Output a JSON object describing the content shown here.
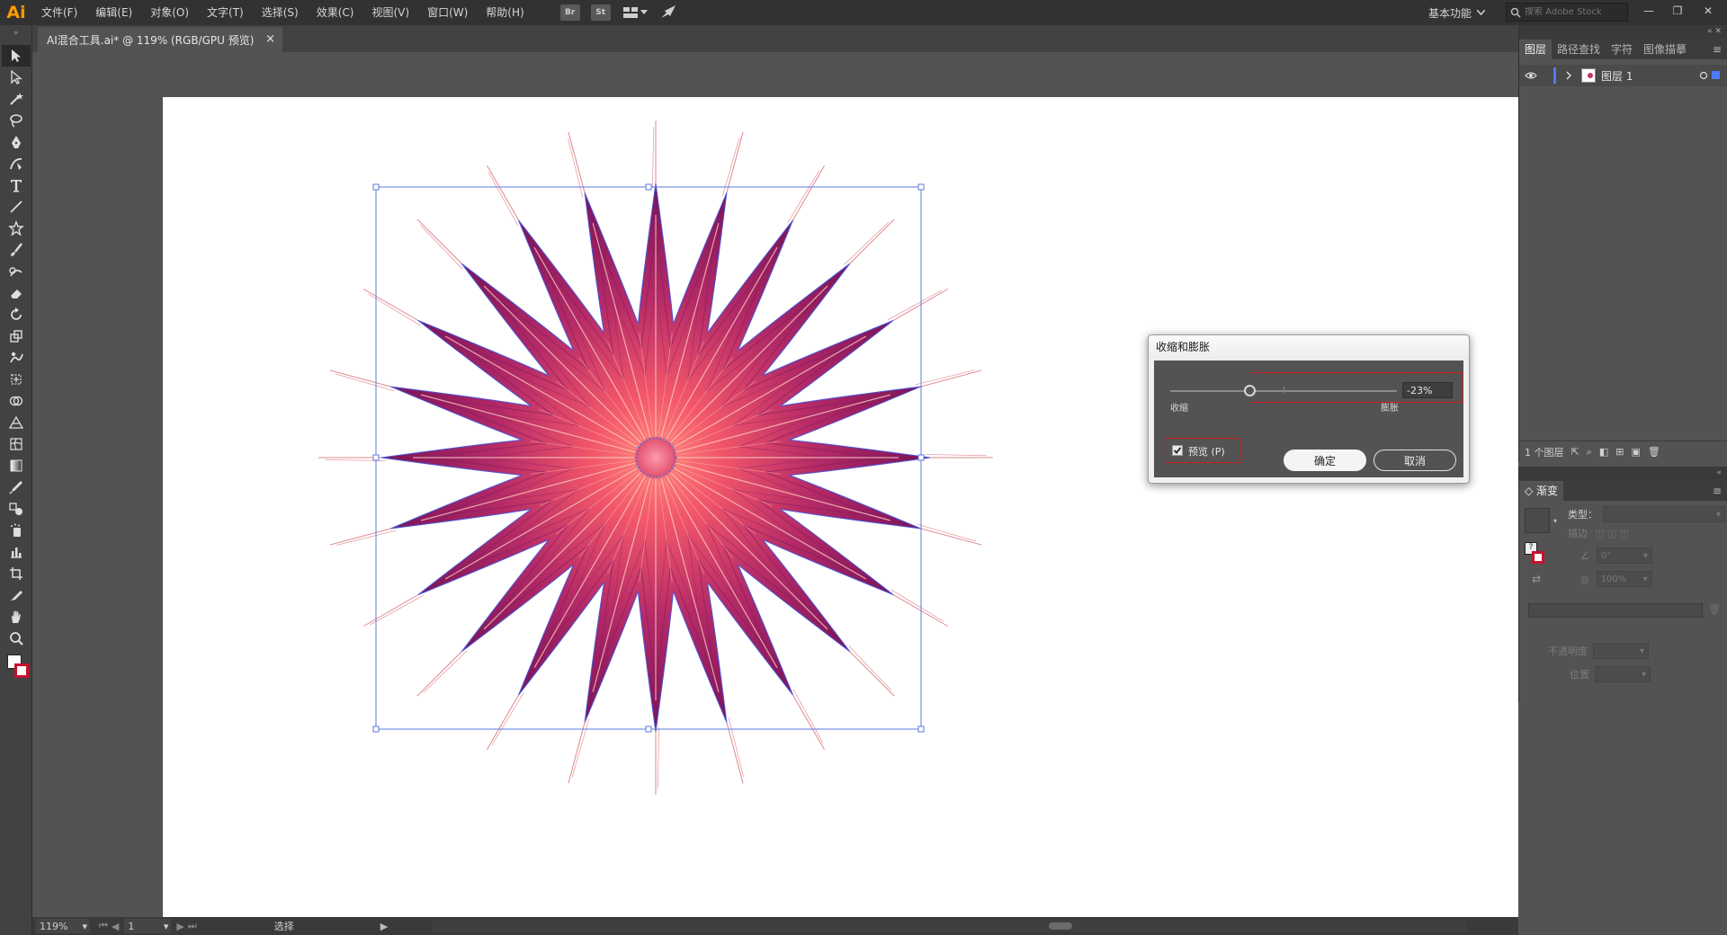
{
  "app": {
    "logo": "Ai",
    "menus": [
      "文件(F)",
      "编辑(E)",
      "对象(O)",
      "文字(T)",
      "选择(S)",
      "效果(C)",
      "视图(V)",
      "窗口(W)",
      "帮助(H)"
    ],
    "menu_icons": [
      "Br",
      "St"
    ],
    "workspace": "基本功能",
    "stock_search_placeholder": "搜索 Adobe Stock"
  },
  "document": {
    "tab_title": "AI混合工具.ai* @ 119% (RGB/GPU 预览)",
    "tab_close": "×"
  },
  "tools": [
    "selection-tool",
    "direct-selection-tool",
    "magic-wand-tool",
    "lasso-tool",
    "pen-tool",
    "curvature-tool",
    "type-tool",
    "line-tool",
    "star-tool",
    "paintbrush-tool",
    "shaper-tool",
    "eraser-tool",
    "rotate-tool",
    "scale-tool",
    "warp-tool",
    "free-transform-tool",
    "shape-builder-tool",
    "perspective-tool",
    "mesh-tool",
    "gradient-tool",
    "eyedropper-tool",
    "blend-tool",
    "symbol-sprayer-tool",
    "graph-tool",
    "artboard-tool",
    "slice-tool",
    "hand-tool",
    "zoom-tool"
  ],
  "layers_panel": {
    "tabs": [
      "图层",
      "路径查找",
      "字符",
      "图像描摹"
    ],
    "active_tab": "图层",
    "layer_name": "图层 1",
    "footer_count": "1 个图层"
  },
  "gradient_panel": {
    "title": "渐变",
    "type_label": "类型：",
    "stroke_label": "描边",
    "angle_value": "0°",
    "aspect_value": "100%",
    "opacity_label": "不透明度",
    "location_label": "位置"
  },
  "dialog": {
    "title": "收缩和膨胀",
    "pucker_label": "收缩",
    "bloat_label": "膨胀",
    "amount": "-23%",
    "slider_percent": -23,
    "preview_label": "预览 (P)",
    "preview_checked": true,
    "ok_label": "确定",
    "cancel_label": "取消"
  },
  "status": {
    "zoom": "119%",
    "artboard_number": "1",
    "tool_name": "选择"
  },
  "colors": {
    "ai_orange": "#ff9a00",
    "selection_blue": "#4a6fe3",
    "highlight_red": "#d01c1c",
    "star_center": "#ff6f66",
    "star_edge": "#6e0f55"
  }
}
